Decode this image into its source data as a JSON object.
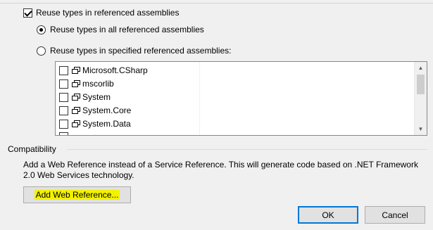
{
  "reuse": {
    "checkbox_label": "Reuse types in referenced assemblies",
    "checkbox_checked": true,
    "radio_all_label": "Reuse types in all referenced assemblies",
    "radio_specified_label": "Reuse types in specified referenced assemblies:",
    "selected": "all"
  },
  "assemblies": [
    {
      "name": "Microsoft.CSharp",
      "checked": false
    },
    {
      "name": "mscorlib",
      "checked": false
    },
    {
      "name": "System",
      "checked": false
    },
    {
      "name": "System.Core",
      "checked": false
    },
    {
      "name": "System.Data",
      "checked": false
    }
  ],
  "compatibility": {
    "title": "Compatibility",
    "description": "Add a Web Reference instead of a Service Reference. This will generate code based on .NET Framework 2.0 Web Services technology.",
    "button_label": "Add Web Reference..."
  },
  "dialog": {
    "ok_label": "OK",
    "cancel_label": "Cancel"
  },
  "colors": {
    "highlight": "#f2f200",
    "default_button_border": "#0078d7"
  }
}
